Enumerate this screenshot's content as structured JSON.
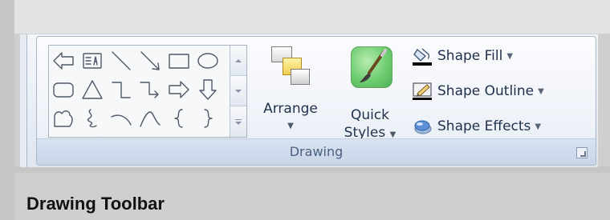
{
  "ribbon": {
    "group_label": "Drawing",
    "shapes_gallery": {
      "shapes": [
        "left-arrow-shape",
        "text-box-shape",
        "line-shape",
        "arrow-line-shape",
        "rectangle-shape",
        "oval-shape",
        "rounded-rectangle-shape",
        "triangle-shape",
        "elbow-connector-shape",
        "elbow-arrow-connector-shape",
        "right-arrow-shape",
        "down-arrow-shape",
        "freeform-shape",
        "scribble-shape",
        "arc-shape",
        "curve-shape",
        "left-brace-shape",
        "right-brace-shape"
      ]
    },
    "arrange": {
      "label": "Arrange",
      "dropdown": "▼"
    },
    "quick_styles": {
      "label_line1": "Quick",
      "label_line2": "Styles",
      "dropdown": "▼"
    },
    "commands": [
      {
        "label": "Shape Fill",
        "icon": "paint-bucket-icon",
        "dropdown": "▼"
      },
      {
        "label": "Shape Outline",
        "icon": "pen-outline-icon",
        "dropdown": "▼"
      },
      {
        "label": "Shape Effects",
        "icon": "shape-effects-icon",
        "dropdown": "▼"
      }
    ]
  },
  "caption": "Drawing Toolbar"
}
